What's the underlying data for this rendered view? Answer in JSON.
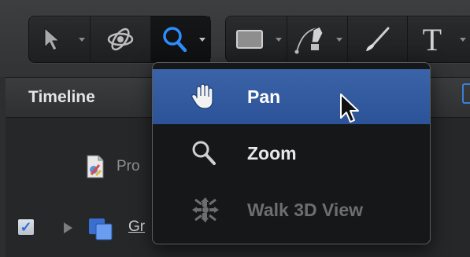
{
  "toolbar": {
    "groups": [
      {
        "tools": [
          {
            "name": "select-arrow-tool",
            "has_menu": true
          },
          {
            "name": "3d-orbit-tool",
            "has_menu": false
          },
          {
            "name": "zoom-tool",
            "has_menu": true,
            "active": true
          }
        ]
      },
      {
        "tools": [
          {
            "name": "rectangle-shape-tool",
            "has_menu": true
          },
          {
            "name": "bezier-pen-tool",
            "has_menu": true
          },
          {
            "name": "paint-stroke-tool",
            "has_menu": false
          },
          {
            "name": "text-tool",
            "has_menu": true,
            "glyph": "T"
          }
        ]
      }
    ]
  },
  "timeline": {
    "title": "Timeline"
  },
  "layers": {
    "project_label": "Pro",
    "group_label": "Gr",
    "group_checked": true
  },
  "view_menu": {
    "items": [
      {
        "label": "Pan",
        "icon": "hand-icon",
        "state": "highlighted"
      },
      {
        "label": "Zoom",
        "icon": "magnifier-icon",
        "state": "normal"
      },
      {
        "label": "Walk 3D View",
        "icon": "walk-3d-icon",
        "state": "disabled"
      }
    ]
  },
  "colors": {
    "menu_highlight": "#2f579b",
    "accent_blue": "#2d8cff",
    "disabled_text": "#6d6e70"
  }
}
